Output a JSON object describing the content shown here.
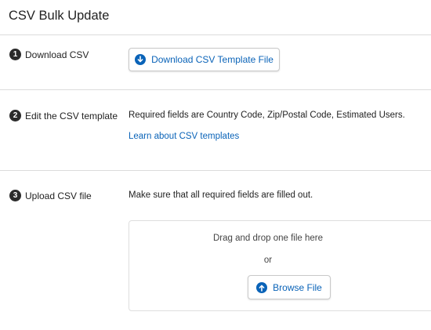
{
  "page": {
    "title": "CSV Bulk Update"
  },
  "steps": [
    {
      "number": "1",
      "label": "Download CSV",
      "button_label": "Download CSV Template File",
      "button_icon": "download-arrow-icon"
    },
    {
      "number": "2",
      "label": "Edit the CSV template",
      "description": "Required fields are Country Code, Zip/Postal Code, Estimated Users.",
      "link_label": "Learn about CSV templates"
    },
    {
      "number": "3",
      "label": "Upload CSV file",
      "description": "Make sure that all required fields are filled out.",
      "dropzone": {
        "drag_text": "Drag and drop one file here",
        "or_text": "or",
        "browse_label": "Browse File",
        "browse_icon": "upload-arrow-icon"
      }
    }
  ],
  "colors": {
    "accent": "#0a63b8",
    "badge": "#2b2b2b"
  }
}
